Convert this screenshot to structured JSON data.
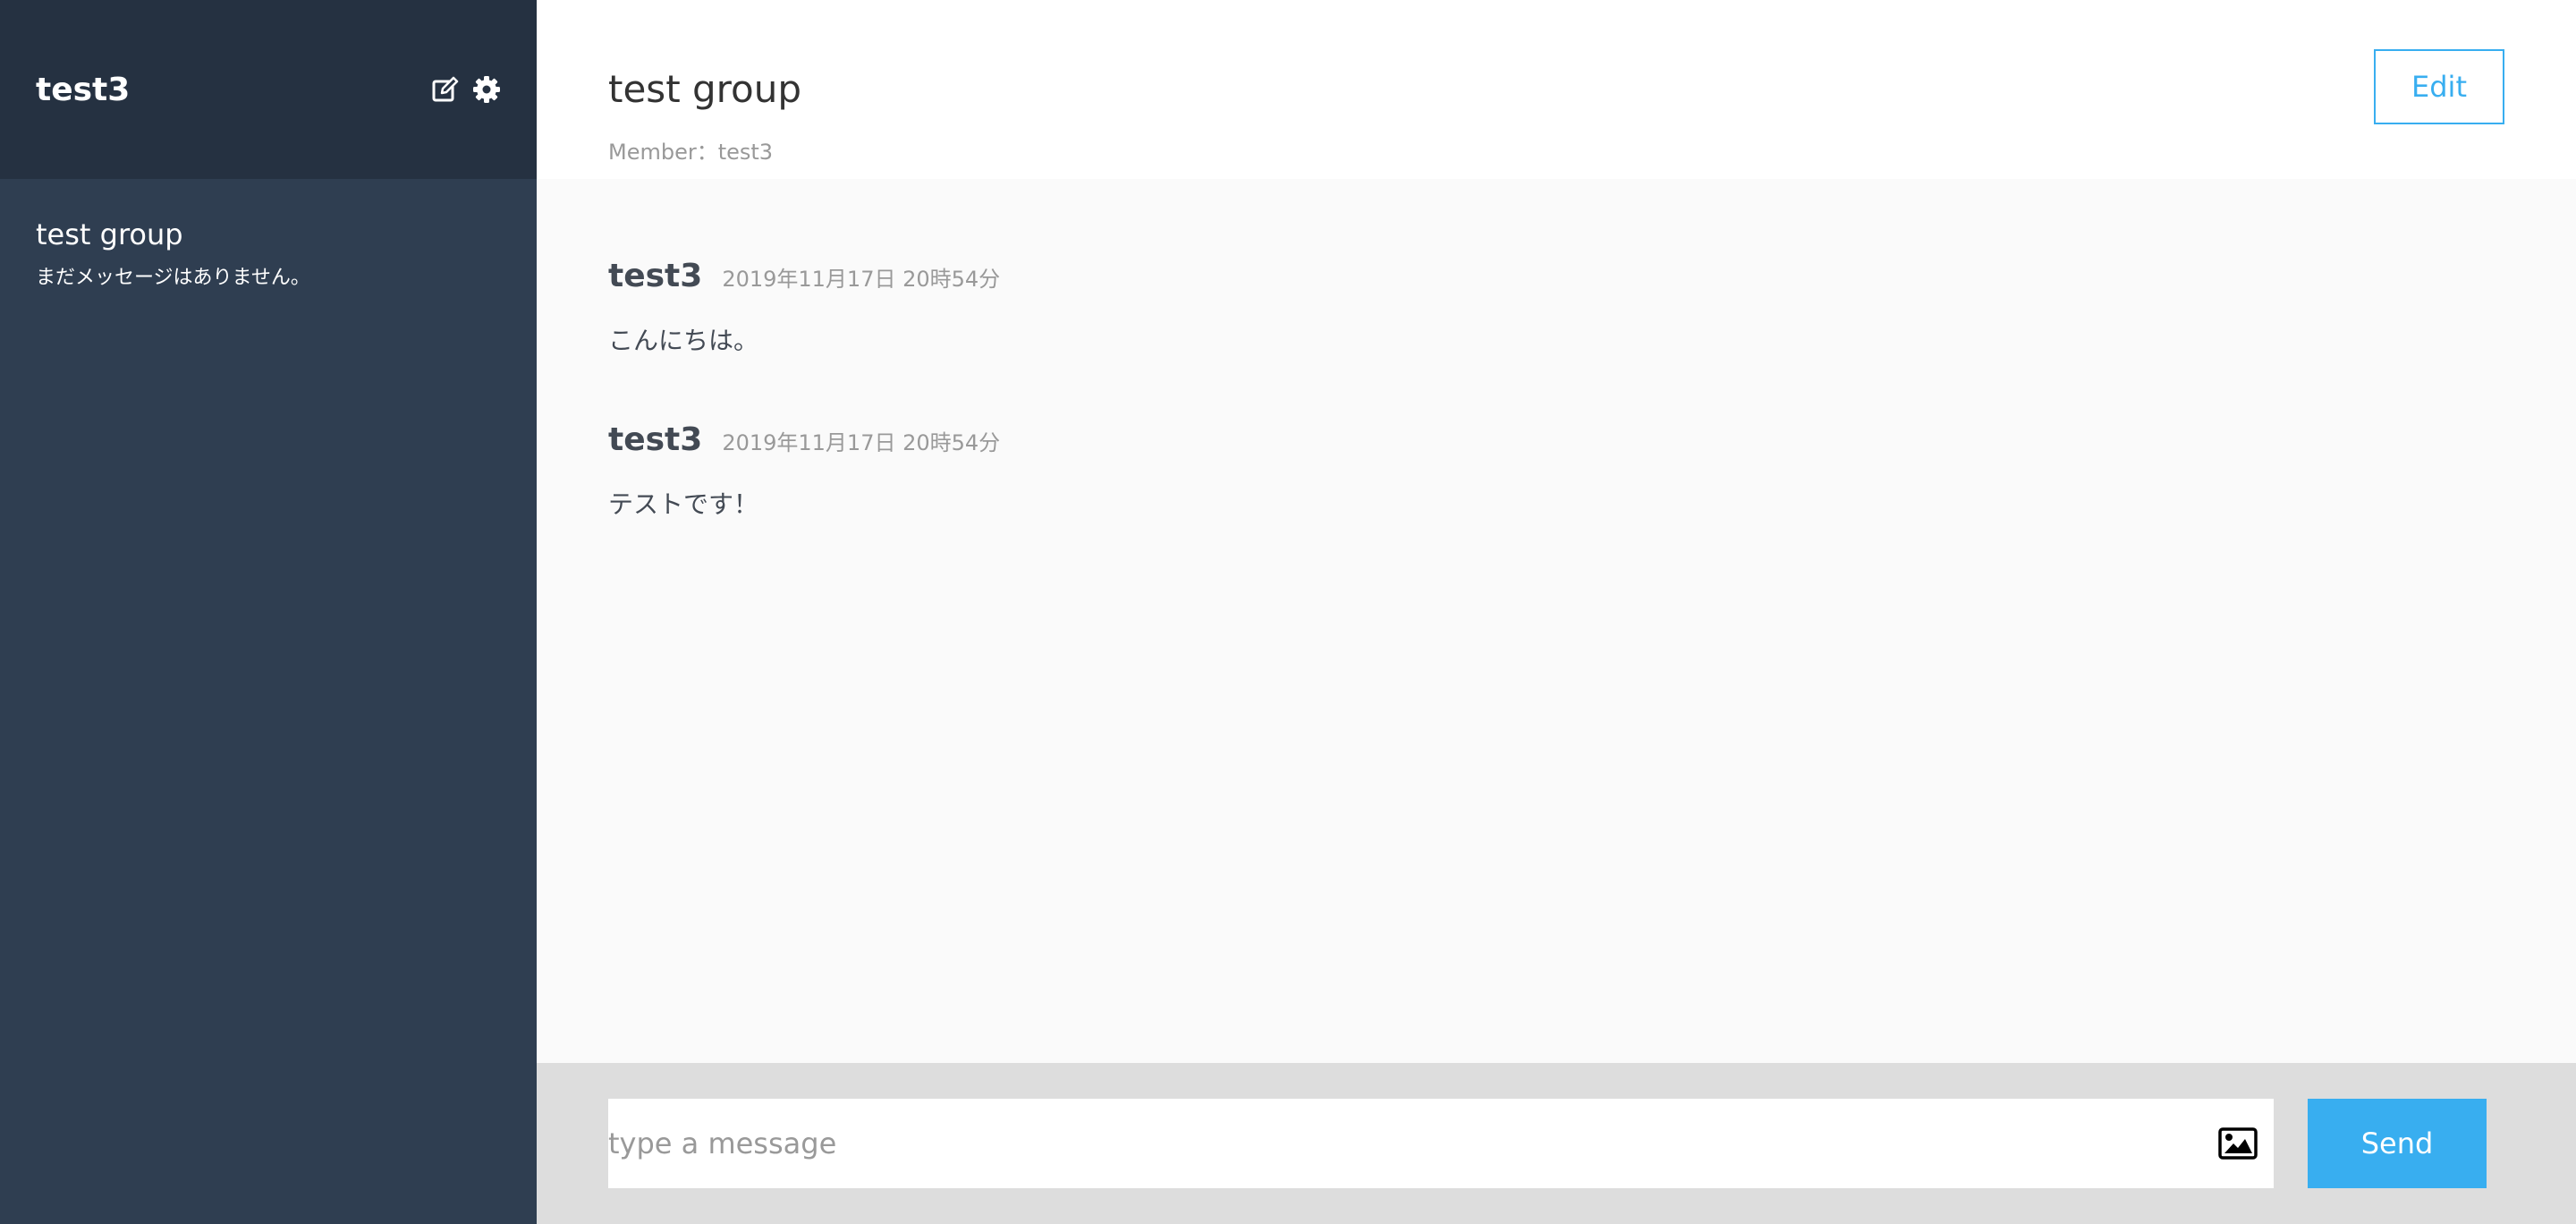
{
  "sidebar": {
    "user_name": "test3",
    "icons": [
      "edit-icon",
      "gear-icon"
    ],
    "groups": [
      {
        "name": "test group",
        "last_message": "まだメッセージはありません。"
      }
    ]
  },
  "main": {
    "group_title": "test group",
    "members": "Member：test3",
    "edit_label": "Edit",
    "messages": [
      {
        "user": "test3",
        "date": "2019年11月17日 20時54分",
        "text": "こんにちは。"
      },
      {
        "user": "test3",
        "date": "2019年11月17日 20時54分",
        "text": "テストです！"
      }
    ]
  },
  "form": {
    "placeholder": "type a message",
    "value": "",
    "image_icon": "image-icon",
    "send_label": "Send"
  },
  "colors": {
    "sidebar_bg": "#2f3e51",
    "sidebar_header_bg": "#253141",
    "accent": "#38aef0",
    "footer_bg": "#dddddd",
    "chat_bg": "#fafafa"
  }
}
